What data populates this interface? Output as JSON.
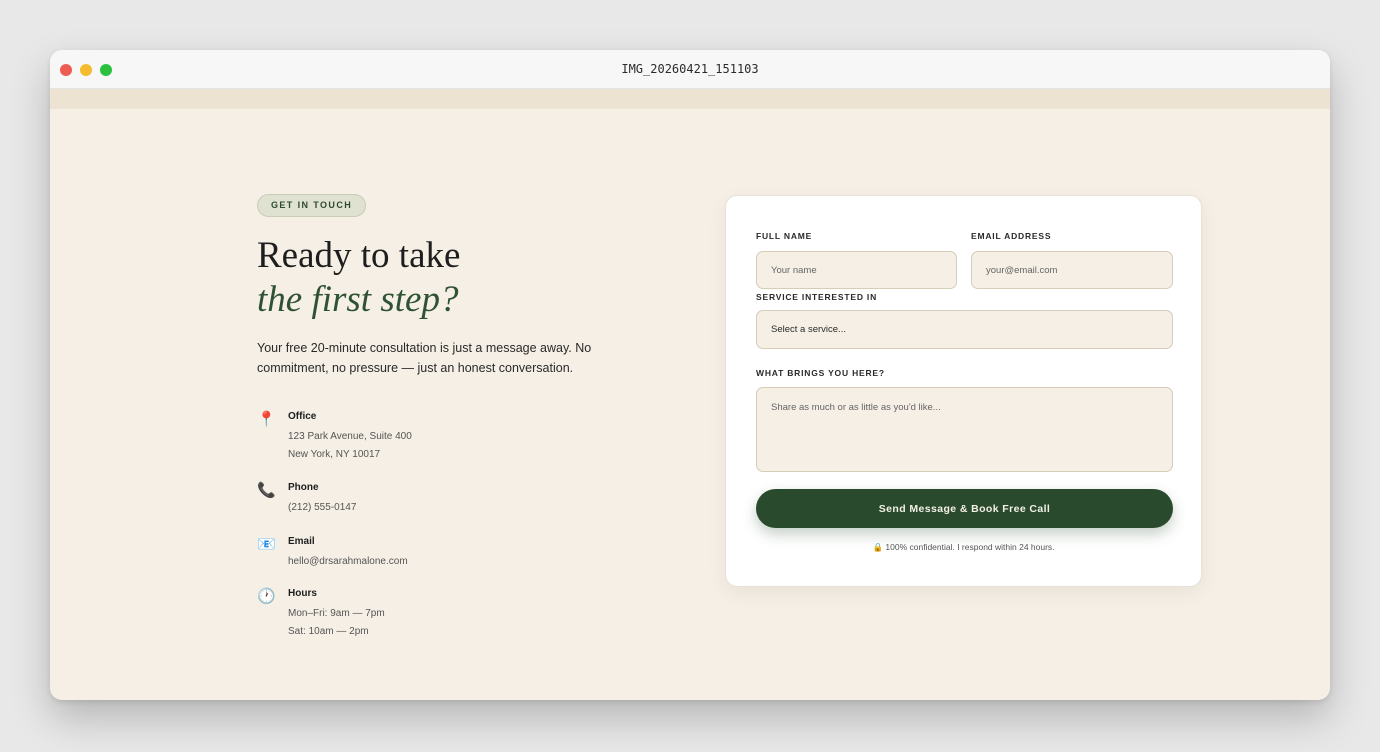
{
  "window": {
    "title": "IMG_20260421_151103"
  },
  "contact": {
    "eyebrow": "GET IN TOUCH",
    "headline": "Ready to take",
    "headline_italic": "the first step?",
    "intro": "Your free 20-minute consultation is just a message away. No commitment, no pressure — just an honest conversation.",
    "office": {
      "icon": "📍",
      "label": "Office",
      "line1": "123 Park Avenue, Suite 400",
      "line2": "New York, NY 10017"
    },
    "phone": {
      "icon": "📞",
      "label": "Phone",
      "line1": "(212) 555-0147"
    },
    "email": {
      "icon": "📧",
      "label": "Email",
      "line1": "hello@drsarahmalone.com"
    },
    "hours": {
      "icon": "🕐",
      "label": "Hours",
      "line1": "Mon–Fri: 9am — 7pm",
      "line2": "Sat: 10am — 2pm"
    }
  },
  "form": {
    "full_name_label": "FULL NAME",
    "full_name_placeholder": "Your name",
    "email_label": "EMAIL ADDRESS",
    "email_placeholder": "your@email.com",
    "service_label": "SERVICE INTERESTED IN",
    "service_value": "Select a service...",
    "message_label": "WHAT BRINGS YOU HERE?",
    "message_placeholder": "Share as much or as little as you'd like...",
    "submit_label": "Send Message & Book Free Call",
    "note": "🔒 100% confidential. I respond within 24 hours."
  }
}
